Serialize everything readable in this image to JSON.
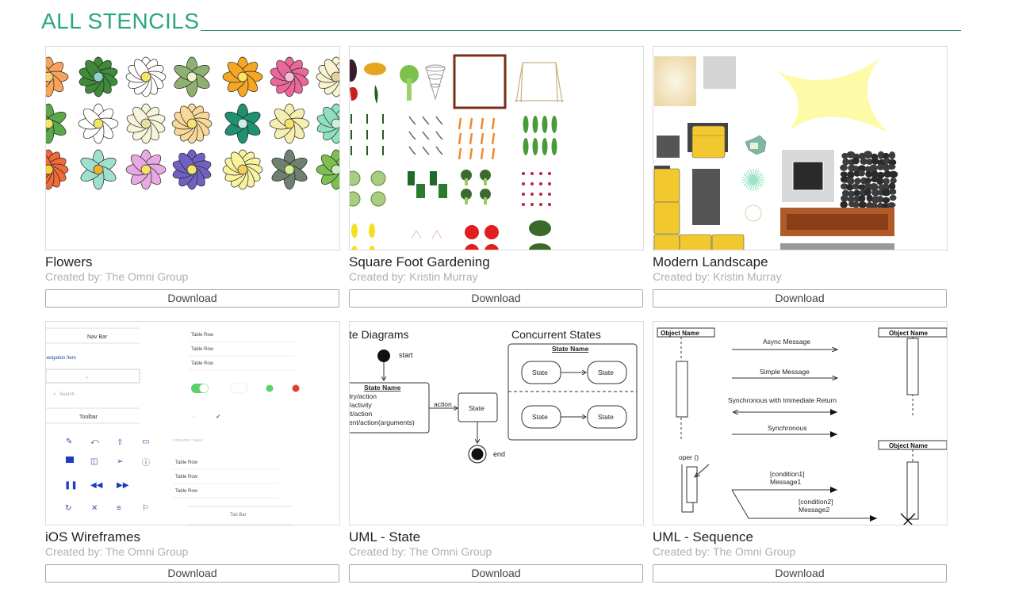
{
  "page": {
    "heading": "ALL STENCILS",
    "accent_color": "#2aa77c"
  },
  "stencils": [
    {
      "title": "Flowers",
      "author": "Created by: The Omni Group",
      "download_label": "Download",
      "preview": "flowers-preview"
    },
    {
      "title": "Square Foot Gardening",
      "author": "Created by: Kristin Murray",
      "download_label": "Download",
      "preview": "gardening-preview"
    },
    {
      "title": "Modern Landscape",
      "author": "Created by: Kristin Murray",
      "download_label": "Download",
      "preview": "landscape-preview"
    },
    {
      "title": "iOS Wireframes",
      "author": "Created by: The Omni Group",
      "download_label": "Download",
      "preview": "ios-wireframes-preview",
      "preview_text": {
        "nav_bar": "Nav Bar",
        "navigation_item": "Navigation Item",
        "search": "Search",
        "toolbar": "Toolbar",
        "table_row": "Table Row",
        "grouped_table": "GROUPED TABLE",
        "tab_bar": "Tab Bar"
      }
    },
    {
      "title": "UML - State",
      "author": "Created by: The Omni Group",
      "download_label": "Download",
      "preview": "uml-state-preview",
      "preview_text": {
        "heading_left": "State Diagrams",
        "heading_right": "Concurrent States",
        "start": "start",
        "end": "end",
        "state_name": "State Name",
        "state": "State",
        "action": "action",
        "lines": [
          "entry/action",
          "do/activity",
          "exit/action",
          "event/action(arguments)"
        ]
      }
    },
    {
      "title": "UML - Sequence",
      "author": "Created by: The Omni Group",
      "download_label": "Download",
      "preview": "uml-sequence-preview",
      "preview_text": {
        "object_name": "Object Name",
        "async": "Async Message",
        "simple": "Simple Message",
        "sync_return": "Synchronous with Immediate Return",
        "sync": "Synchronous",
        "oper": "oper ()",
        "cond1": "[condition1]",
        "msg1": "Message1",
        "cond2": "[condition2]",
        "msg2": "Message2"
      }
    }
  ]
}
